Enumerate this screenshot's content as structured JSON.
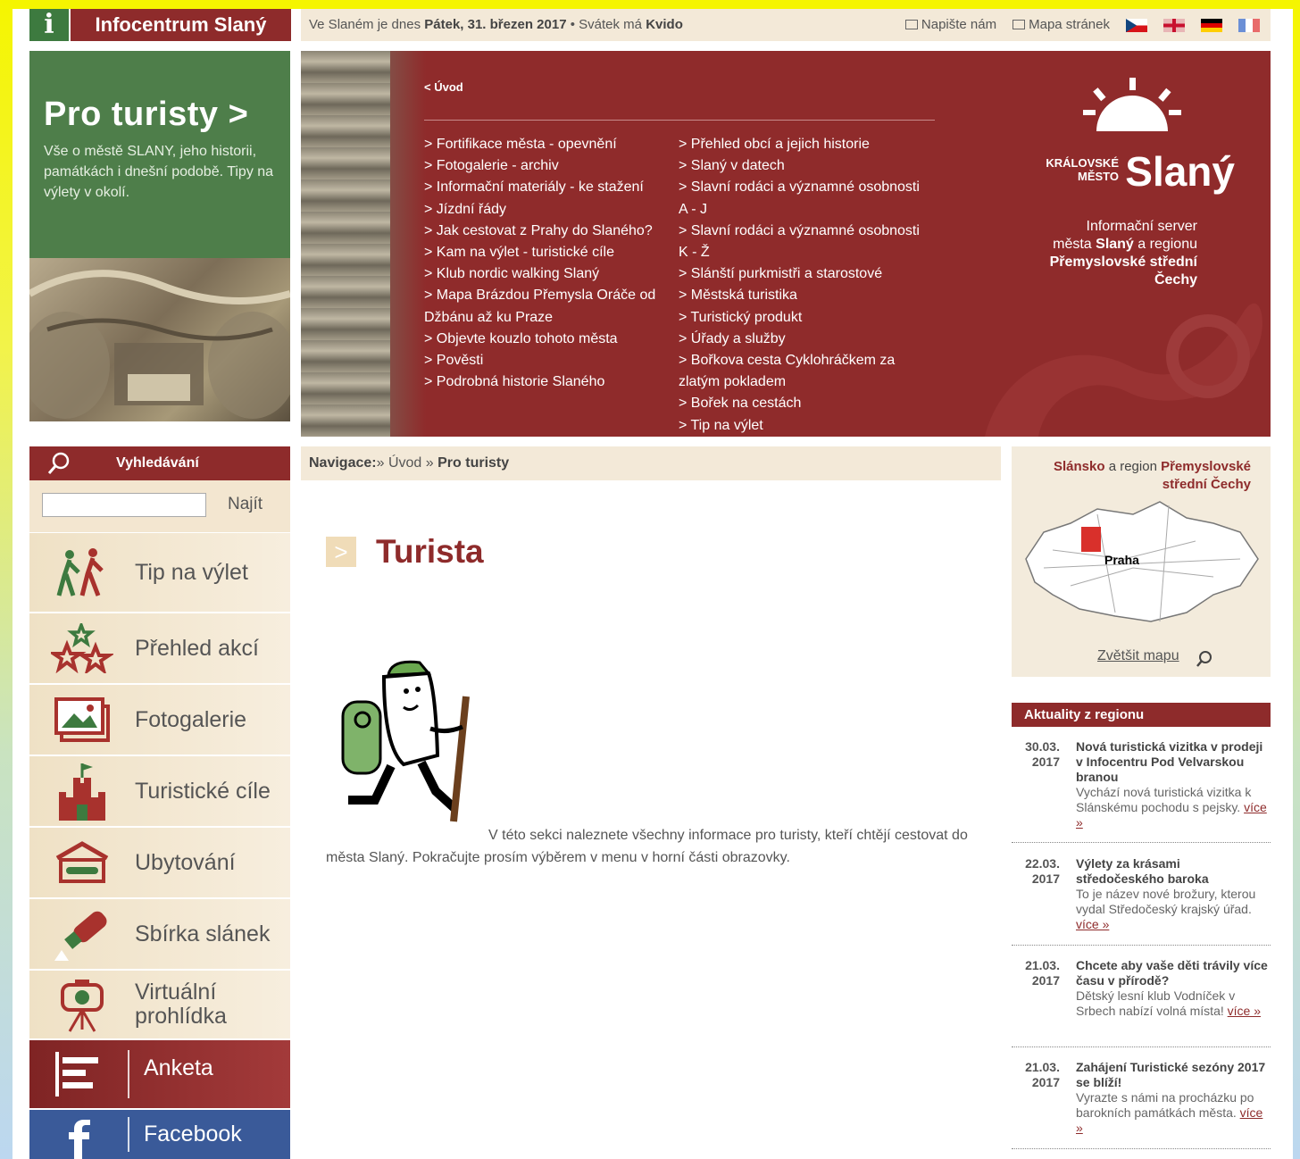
{
  "logo": {
    "icon_letter": "i",
    "name": "Infocentrum Slaný"
  },
  "topbar": {
    "date_prefix": "Ve Slaném je dnes",
    "date": "Pátek, 31. březen 2017",
    "sep": "•",
    "nameday_prefix": "Svátek má",
    "nameday": "Kvido",
    "write_us": "Napište nám",
    "sitemap": "Mapa stránek"
  },
  "promo": {
    "title": "Pro turisty >",
    "text": "Vše o městě SLANY, jeho historii, památkách i dnešní podobě. Tipy na výlety v okolí."
  },
  "hero": {
    "back_link": "< Úvod",
    "menu_left": [
      "> Fortifikace města - opevnění",
      "> Fotogalerie - archiv",
      "> Informační materiály - ke stažení",
      "> Jízdní řády",
      "> Jak cestovat z Prahy do Slaného?",
      "> Kam na výlet - turistické cíle",
      "> Klub nordic walking Slaný",
      "> Mapa Brázdou Přemysla Oráče od Džbánu až ku Praze",
      "> Objevte kouzlo tohoto města",
      "> Pověsti",
      "> Podrobná historie Slaného"
    ],
    "menu_right": [
      "> Přehled obcí a jejich historie",
      "> Slaný v datech",
      "> Slavní rodáci a významné osobnosti A - J",
      "> Slavní rodáci a významné osobnosti K - Ž",
      "> Slánští purkmistři a starostové",
      "> Městská turistika",
      "> Turistický produkt",
      "> Úřady a služby",
      "> Bořkova cesta Cyklohráčkem za zlatým pokladem",
      "> Bořek na cestách",
      "> Tip na výlet"
    ],
    "brand_kral": "KRÁLOVSKÉ",
    "brand_mesto": "MĚSTO",
    "brand_name": "Slaný",
    "info_line1": "Informační server",
    "info_line2a": "města",
    "info_line2b": "Slaný",
    "info_line2c": "a regionu",
    "info_line3": "Přemyslovské střední Čechy"
  },
  "search": {
    "title": "Vyhledávání",
    "button": "Najít",
    "value": ""
  },
  "side_menu": [
    {
      "label": "Tip na výlet",
      "icon": "hikers-icon"
    },
    {
      "label": "Přehled akcí",
      "icon": "stars-icon"
    },
    {
      "label": "Fotogalerie",
      "icon": "photo-icon"
    },
    {
      "label": "Turistické cíle",
      "icon": "castle-icon"
    },
    {
      "label": "Ubytování",
      "icon": "bed-icon"
    },
    {
      "label": "Sbírka slánek",
      "icon": "salt-shaker-icon"
    },
    {
      "label": "Virtuální prohlídka",
      "icon": "camera-tripod-icon"
    },
    {
      "label": "Anketa",
      "icon": "poll-icon"
    },
    {
      "label": "Facebook",
      "icon": "facebook-icon"
    }
  ],
  "navigation": {
    "prefix": "Navigace:",
    "sep": "»",
    "home": "Úvod",
    "current": "Pro turisty"
  },
  "page": {
    "title_mark": ">",
    "title": "Turista",
    "intro": "V této sekci naleznete všechny informace pro turisty, kteří chtějí cestovat do města Slaný. Pokračujte prosím výběrem v menu v horní části obrazovky."
  },
  "map": {
    "title_a": "Slánsko",
    "title_b": "a region",
    "title_c": "Přemyslovské střední Čechy",
    "city_label": "Praha",
    "enlarge": "Zvětšit mapu"
  },
  "news": {
    "title": "Aktuality z regionu",
    "more": "více »",
    "items": [
      {
        "date": "30.03. 2017",
        "title": "Nová turistická vizitka v prodeji v Infocentru Pod Velvarskou branou",
        "text": "Vychází nová turistická vizitka k Slánskému pochodu s pejsky."
      },
      {
        "date": "22.03. 2017",
        "title": "Výlety za krásami středočeského baroka",
        "text": "To je název nové brožury, kterou vydal Středočeský krajský úřad."
      },
      {
        "date": "21.03. 2017",
        "title": "Chcete aby vaše děti trávily více času v přírodě?",
        "text": "Dětský lesní klub Vodníček v Srbech nabízí volná místa!"
      },
      {
        "date": "21.03. 2017",
        "title": "Zahájení Turistické sezóny 2017 se blíží!",
        "text": "Vyrazte s námi na procházku po barokních památkách města."
      }
    ]
  },
  "colors": {
    "brand_red": "#8e2b2b",
    "brand_green": "#4e7e4a",
    "cream": "#f3e9d8"
  }
}
